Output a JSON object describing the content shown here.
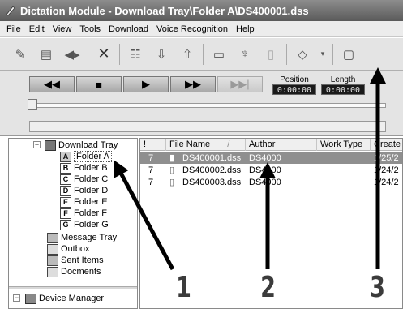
{
  "window": {
    "title": "Dictation Module - Download Tray\\Folder A\\DS400001.dss"
  },
  "menu": [
    "File",
    "Edit",
    "View",
    "Tools",
    "Download",
    "Voice Recognition",
    "Help"
  ],
  "toolbar": {
    "icons": [
      "pen-icon",
      "document-icon",
      "split-icon",
      "delete-icon",
      "properties-icon",
      "download-icon",
      "upload-icon",
      "folder-icon",
      "recognize-icon",
      "transcribe-icon",
      "send-icon",
      "dropdown-icon",
      "comment-icon"
    ]
  },
  "transport": {
    "rewind": "◀◀",
    "stop": "■",
    "play": "▶",
    "fastforward": "▶▶",
    "next": "▶▶|",
    "position_label": "Position",
    "position_value": "0:00:00",
    "length_label": "Length",
    "length_value": "0:00:00"
  },
  "tree": {
    "root": "Download Tray",
    "folders": [
      "Folder A",
      "Folder B",
      "Folder C",
      "Folder D",
      "Folder E",
      "Folder F",
      "Folder G"
    ],
    "folder_letters": [
      "A",
      "B",
      "C",
      "D",
      "E",
      "F",
      "G"
    ],
    "others": [
      "Message Tray",
      "Outbox",
      "Sent Items",
      "Docments"
    ],
    "device_manager": "Device Manager"
  },
  "list": {
    "columns": [
      "!",
      "File Name",
      "Author",
      "Work Type",
      "Create"
    ],
    "sort_indicator": "/",
    "rows": [
      {
        "priority": "7",
        "file_name": "DS400001.dss",
        "author": "DS4000",
        "work_type": "",
        "created": "1/25/2"
      },
      {
        "priority": "7",
        "file_name": "DS400002.dss",
        "author": "DS4000",
        "work_type": "",
        "created": "1/24/2"
      },
      {
        "priority": "7",
        "file_name": "DS400003.dss",
        "author": "DS4000",
        "work_type": "",
        "created": "1/24/2"
      }
    ]
  },
  "callouts": [
    "1",
    "2",
    "3"
  ]
}
